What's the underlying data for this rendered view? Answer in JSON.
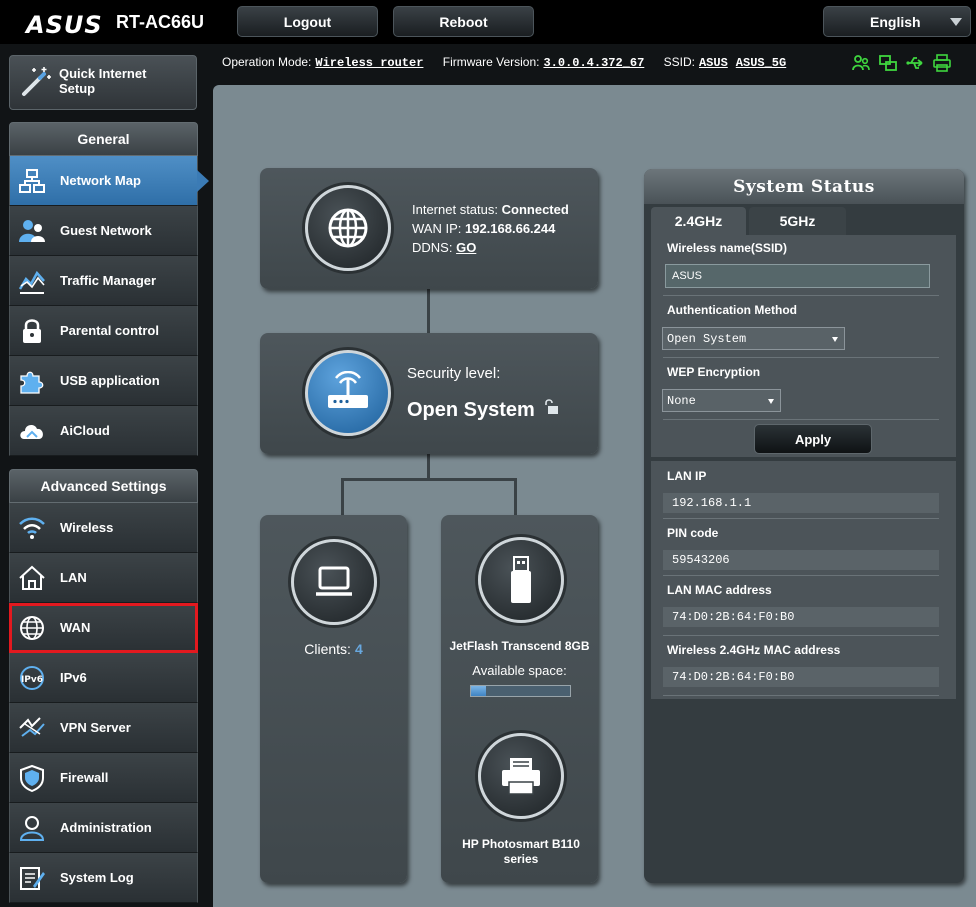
{
  "header": {
    "brand": "ASUS",
    "model": "RT-AC66U",
    "logout_label": "Logout",
    "reboot_label": "Reboot",
    "language": "English"
  },
  "status_line": {
    "op_mode_label": "Operation Mode:",
    "op_mode_value": "Wireless router",
    "firmware_label": "Firmware Version:",
    "firmware_value": "3.0.0.4.372_67",
    "ssid_label": "SSID:",
    "ssid_values": [
      "ASUS",
      "ASUS_5G"
    ],
    "icons": [
      "users-icon",
      "network-icon",
      "usb-icon",
      "printer-icon"
    ]
  },
  "sidebar": {
    "quick_setup_label": "Quick Internet Setup",
    "general_header": "General",
    "general_items": [
      {
        "label": "Network Map",
        "icon": "network-map-icon"
      },
      {
        "label": "Guest Network",
        "icon": "guest-network-icon"
      },
      {
        "label": "Traffic Manager",
        "icon": "traffic-manager-icon"
      },
      {
        "label": "Parental control",
        "icon": "lock-icon"
      },
      {
        "label": "USB application",
        "icon": "puzzle-icon"
      },
      {
        "label": "AiCloud",
        "icon": "cloud-icon"
      }
    ],
    "advanced_header": "Advanced Settings",
    "advanced_items": [
      {
        "label": "Wireless",
        "icon": "wifi-icon"
      },
      {
        "label": "LAN",
        "icon": "home-icon"
      },
      {
        "label": "WAN",
        "icon": "globe-icon"
      },
      {
        "label": "IPv6",
        "icon": "ipv6-icon"
      },
      {
        "label": "VPN Server",
        "icon": "vpn-icon"
      },
      {
        "label": "Firewall",
        "icon": "shield-icon"
      },
      {
        "label": "Administration",
        "icon": "admin-icon"
      },
      {
        "label": "System Log",
        "icon": "system-log-icon"
      }
    ]
  },
  "network_map": {
    "internet_status_label": "Internet status:",
    "internet_status_value": "Connected",
    "wan_ip_label": "WAN IP:",
    "wan_ip_value": "192.168.66.244",
    "ddns_label": "DDNS:",
    "ddns_value": "GO",
    "security_label": "Security level:",
    "security_value": "Open System",
    "clients_label": "Clients:",
    "clients_count": "4",
    "usb_device": "JetFlash Transcend 8GB",
    "usb_space_label": "Available space:",
    "usb_used_fraction": 0.15,
    "printer_name": "HP Photosmart B110 series"
  },
  "system_status": {
    "title": "System Status",
    "tabs": [
      "2.4GHz",
      "5GHz"
    ],
    "wireless_name_label": "Wireless name(SSID)",
    "wireless_name_value": "ASUS",
    "auth_label": "Authentication Method",
    "auth_value": "Open System",
    "wep_label": "WEP Encryption",
    "wep_value": "None",
    "apply_label": "Apply",
    "lan_ip_label": "LAN IP",
    "lan_ip_value": "192.168.1.1",
    "pin_label": "PIN code",
    "pin_value": "59543206",
    "lan_mac_label": "LAN MAC address",
    "lan_mac_value": "74:D0:2B:64:F0:B0",
    "wl_mac_label": "Wireless 2.4GHz MAC address",
    "wl_mac_value": "74:D0:2B:64:F0:B0"
  },
  "colors": {
    "accent_blue": "#3b7bb5",
    "highlight_red": "#e3191f",
    "status_green": "#3fd63f"
  }
}
